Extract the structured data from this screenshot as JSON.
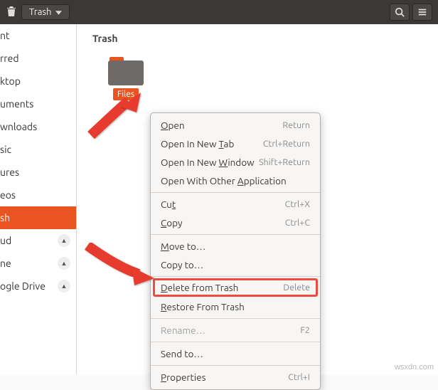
{
  "topbar": {
    "title": "Trash"
  },
  "sidebar": {
    "items": [
      {
        "label": "nt"
      },
      {
        "label": "rred"
      },
      {
        "label": "ktop"
      },
      {
        "label": "uments"
      },
      {
        "label": "wnloads"
      },
      {
        "label": "sic"
      },
      {
        "label": "ures"
      },
      {
        "label": "eos"
      },
      {
        "label": "sh",
        "selected": true
      },
      {
        "label": "ud",
        "eject": true
      },
      {
        "label": "ne",
        "eject": true
      },
      {
        "label": "ogle Drive",
        "eject": true
      }
    ]
  },
  "content": {
    "heading": "Trash",
    "folder_label": "Files"
  },
  "menu": {
    "open": {
      "label": "Open",
      "accel": "Return",
      "u": 0
    },
    "open_tab": {
      "label": "Open In New Tab",
      "accel": "Ctrl+Return",
      "u": 12
    },
    "open_win": {
      "label": "Open In New Window",
      "accel": "Shift+Return",
      "u": 12
    },
    "open_app": {
      "label": "Open With Other Application",
      "u": 16
    },
    "cut": {
      "label": "Cut",
      "accel": "Ctrl+X",
      "u": 2
    },
    "copy": {
      "label": "Copy",
      "accel": "Ctrl+C",
      "u": 0
    },
    "move_to": {
      "label": "Move to…",
      "u": 0
    },
    "copy_to": {
      "label": "Copy to…"
    },
    "delete": {
      "label": "Delete from Trash",
      "accel": "Delete",
      "u": 0
    },
    "restore": {
      "label": "Restore From Trash",
      "u": 0
    },
    "rename": {
      "label": "Rename…",
      "accel": "F2",
      "disabled": true
    },
    "send_to": {
      "label": "Send to…"
    },
    "properties": {
      "label": "Properties",
      "accel": "Ctrl+I",
      "u": 0
    }
  },
  "watermark": "wsxdn.com"
}
